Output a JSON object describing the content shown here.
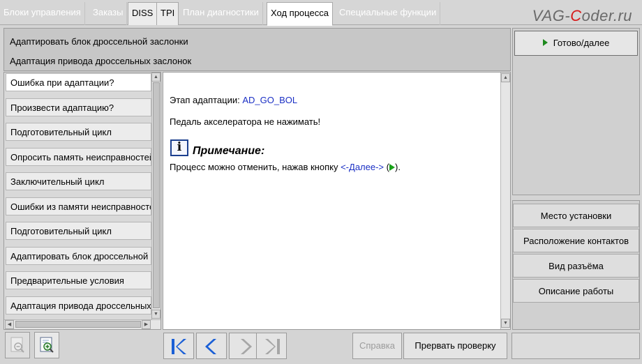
{
  "tabs": [
    {
      "label": "Блоки управления",
      "state": "disabled"
    },
    {
      "label": "Заказы",
      "state": "disabled"
    },
    {
      "label": "DISS",
      "state": "enabled"
    },
    {
      "label": "TPI",
      "state": "enabled"
    },
    {
      "label": "План диагностики",
      "state": "disabled"
    },
    {
      "label": "Ход процесса",
      "state": "active"
    },
    {
      "label": "Специальные функции",
      "state": "disabled"
    }
  ],
  "logo": {
    "prefix": "VAG-",
    "c": "C",
    "suffix": "oder.ru"
  },
  "header": {
    "line1": "Адаптировать блок дроссельной заслонки",
    "line2": "Адаптация привода дроссельных заслонок"
  },
  "steps": [
    "Ошибка при адаптации?",
    "Произвести адаптацию?",
    "Подготовительный цикл",
    "Опросить память неисправностей",
    "Заключительный цикл",
    "Ошибки из памяти неисправностей",
    "Подготовительный цикл",
    "Адаптировать блок дроссельной заслонки",
    "Предварительные условия",
    "Адаптация привода дроссельных заслонок"
  ],
  "content": {
    "stage_label": "Этап адаптации:",
    "stage_value": "AD_GO_BOL",
    "instruction": "Педаль акселератора не нажимать!",
    "info_icon_glyph": "i",
    "note_title": "Примечание:",
    "note_text": "Процесс можно отменить, нажав кнопку",
    "note_link": "<-Далее->",
    "note_paren_open": "(",
    "note_paren_close": ")."
  },
  "right_panel": {
    "ready_button": "Готово/далее",
    "buttons": [
      "Место установки",
      "Расположение контактов",
      "Вид разъёма",
      "Описание работы"
    ]
  },
  "toolbar": {
    "help_button": "Справка",
    "abort_button": "Прервать проверку"
  },
  "colors": {
    "link": "#1a2fc4",
    "nav_arrow": "#1a5fd6",
    "play_green": "#19a119",
    "logo_red": "#d61818"
  }
}
